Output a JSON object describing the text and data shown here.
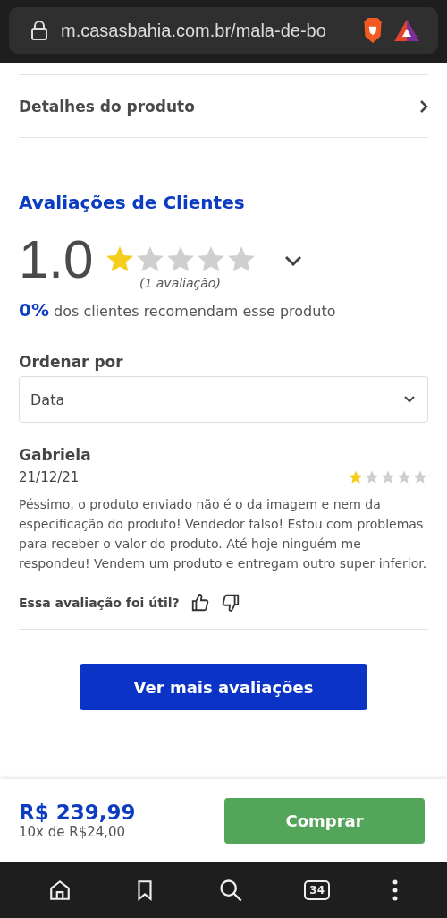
{
  "browser": {
    "url": "m.casasbahia.com.br/mala-de-bo",
    "tab_count": "34"
  },
  "details_row": {
    "label": "Detalhes do produto"
  },
  "reviews": {
    "title": "Avaliações de Clientes",
    "score": "1.0",
    "stars": 1,
    "count": "(1 avaliação)",
    "recommend": "**0%** dos clientes recomendam esse produto",
    "sort": {
      "label": "Ordenar por",
      "value": "Data"
    },
    "items": [
      {
        "author": "Gabriela",
        "date": "21/12/21",
        "stars": 1,
        "text": "Péssimo, o produto enviado não é o da imagem e nem da especificação do produto! Vendedor falso! Estou com problemas para receber o valor do produto. Até hoje ninguém me respondeu! Vendem um produto e entregam outro super inferior.",
        "helpful": "Essa avaliação foi útil?"
      }
    ],
    "more_button": "Ver mais avaliações"
  },
  "buy_bar": {
    "price": "R$ 239,99",
    "installments": "10x de R$24,00",
    "button": "Comprar"
  }
}
